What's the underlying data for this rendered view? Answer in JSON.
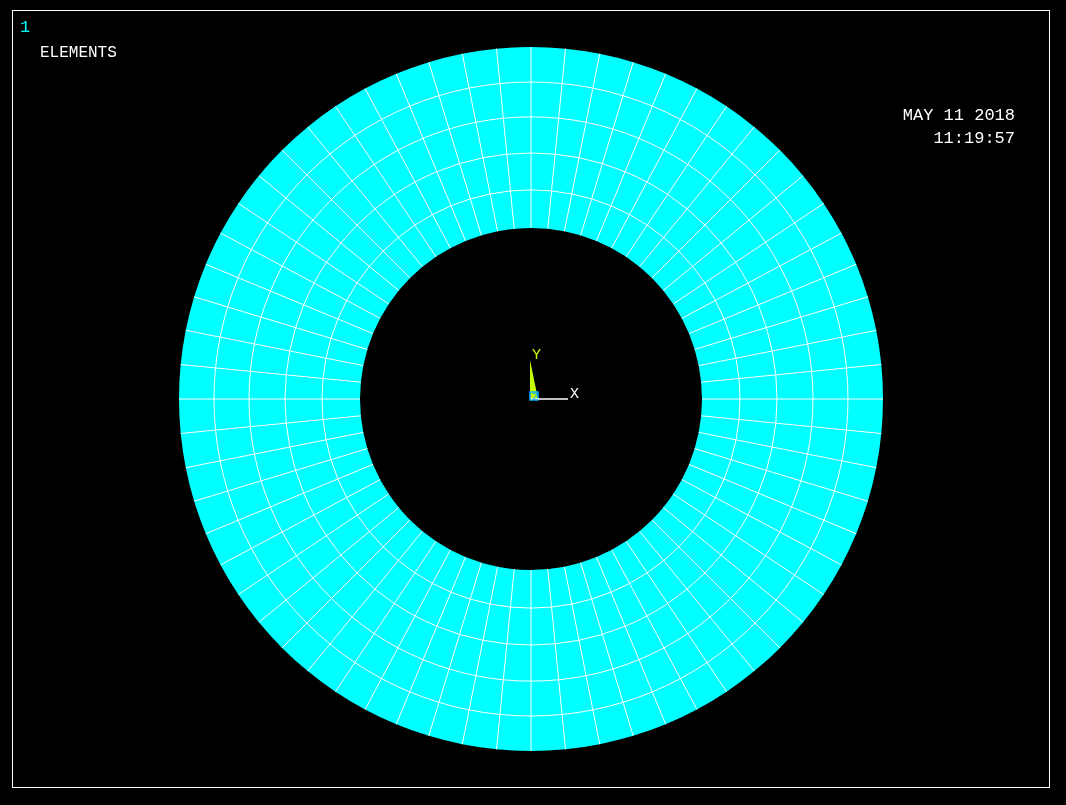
{
  "window_number": "1",
  "plot_label": "ELEMENTS",
  "date": "MAY 11 2018",
  "time": "11:19:57",
  "triad": {
    "y_label": "Y",
    "z_label": "Z",
    "x_label": "X"
  }
}
